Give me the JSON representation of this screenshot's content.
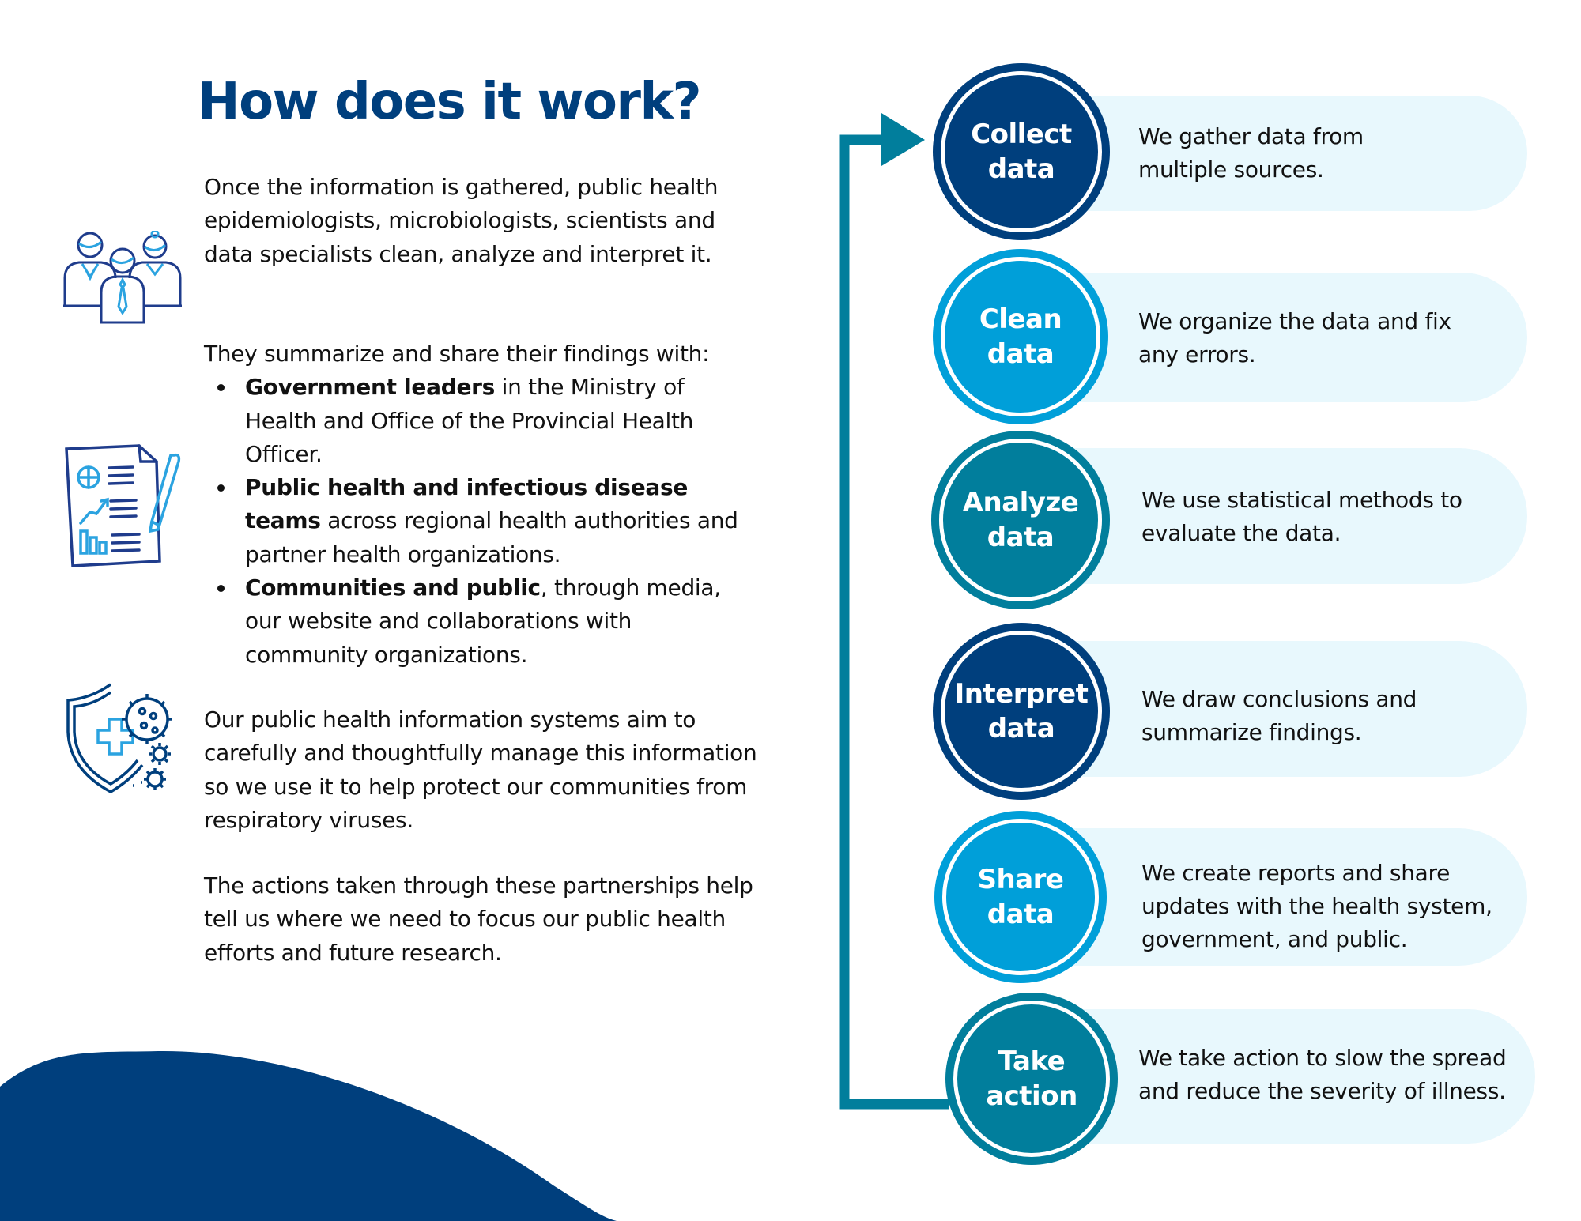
{
  "title": "How does it work?",
  "colors": {
    "navy": "#003F7D",
    "sky": "#009FD9",
    "teal": "#017E9C",
    "pill_bg": "#E8F8FD",
    "icon_dark": "#1F3C8C",
    "icon_light": "#2BA3E0"
  },
  "left": {
    "icons": [
      "people-icon",
      "report-icon",
      "shield-virus-icon"
    ],
    "paragraph1": "Once the information is gathered, public health epidemiologists, microbiologists, scientists and data specialists clean, analyze and interpret it.",
    "paragraph2_intro": "They summarize and share their findings with:",
    "findings": [
      {
        "bold": "Government leaders",
        "rest": " in the Ministry of Health and Office of the Provincial Health Officer."
      },
      {
        "bold": "Public health and infectious disease teams",
        "rest": " across regional health authorities and partner health organizations."
      },
      {
        "bold": "Communities and public",
        "rest": ", through media, our website and collaborations with community organizations."
      }
    ],
    "paragraph3": "Our public health information systems aim to carefully and thoughtfully manage this information so we use it to help protect our communities from respiratory viruses.",
    "paragraph4": "The actions taken through these partnerships help tell us where we need to focus our public health efforts and future research."
  },
  "steps": [
    {
      "label_line1": "Collect",
      "label_line2": "data",
      "description": "We gather data from multiple sources.",
      "color": "navy"
    },
    {
      "label_line1": "Clean",
      "label_line2": "data",
      "description": "We organize the data and fix any errors.",
      "color": "sky"
    },
    {
      "label_line1": "Analyze",
      "label_line2": "data",
      "description": "We use statistical methods to evaluate the data.",
      "color": "teal"
    },
    {
      "label_line1": "Interpret",
      "label_line2": "data",
      "description": "We draw conclusions and summarize findings.",
      "color": "navy"
    },
    {
      "label_line1": "Share",
      "label_line2": "data",
      "description": "We create reports and share updates with the health system, government, and public.",
      "color": "sky"
    },
    {
      "label_line1": "Take",
      "label_line2": "action",
      "description": "We take action to slow the spread and reduce the severity of illness.",
      "color": "teal"
    }
  ]
}
